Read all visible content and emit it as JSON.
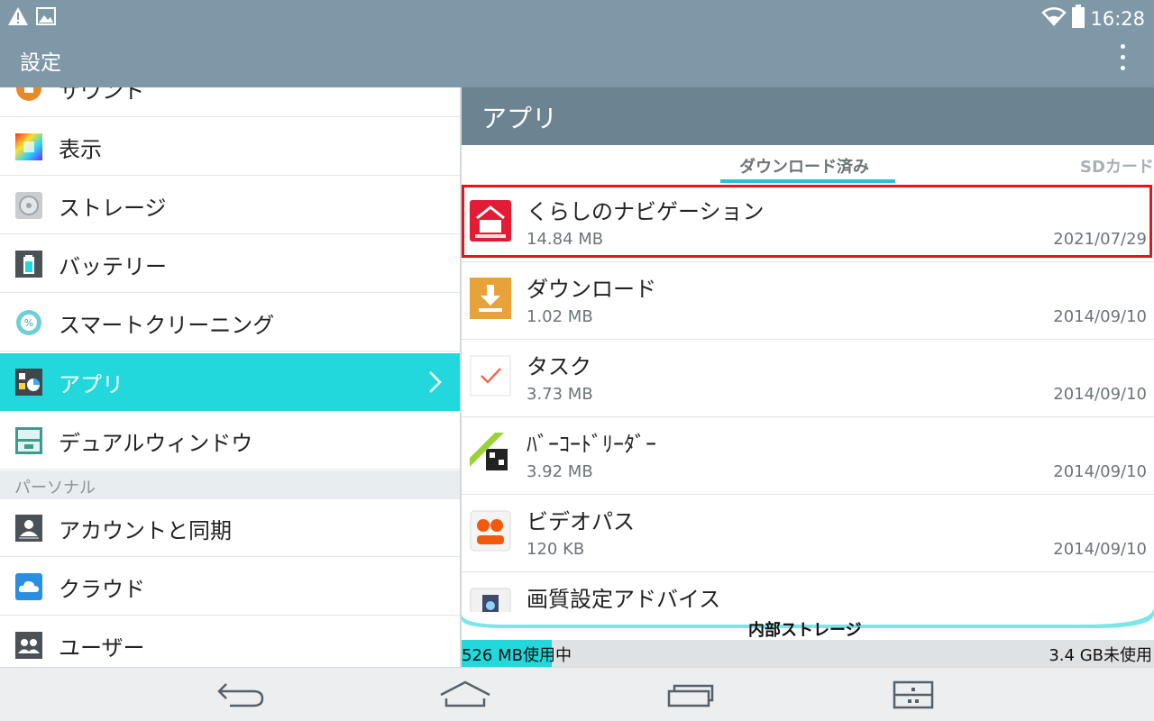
{
  "status_bar": {
    "time": "16:28",
    "icons": [
      "warning-icon",
      "image-icon",
      "wifi-icon",
      "battery-icon"
    ]
  },
  "action_bar": {
    "title": "設定",
    "overflow_icon": "more-vert-icon"
  },
  "sidebar": {
    "items": [
      {
        "label": "サウンド",
        "icon": "sound-icon"
      },
      {
        "label": "表示",
        "icon": "display-icon"
      },
      {
        "label": "ストレージ",
        "icon": "storage-icon"
      },
      {
        "label": "バッテリー",
        "icon": "battery-icon"
      },
      {
        "label": "スマートクリーニング",
        "icon": "smart-cleaning-icon"
      },
      {
        "label": "アプリ",
        "icon": "apps-icon",
        "active": true
      },
      {
        "label": "デュアルウィンドウ",
        "icon": "dual-window-icon"
      }
    ],
    "section_personal": "パーソナル",
    "personal_items": [
      {
        "label": "アカウントと同期",
        "icon": "account-sync-icon"
      },
      {
        "label": "クラウド",
        "icon": "cloud-icon"
      },
      {
        "label": "ユーザー",
        "icon": "users-icon"
      }
    ]
  },
  "apps_panel": {
    "title": "アプリ",
    "tabs": [
      {
        "label": "ダウンロード済み",
        "selected": true
      },
      {
        "label": "SDカード"
      }
    ],
    "apps": [
      {
        "name": "くらしのナビゲーション",
        "size": "14.84 MB",
        "date": "2021/07/29",
        "icon": "kurashi-navigation-icon"
      },
      {
        "name": "ダウンロード",
        "size": "1.02 MB",
        "date": "2014/09/10",
        "icon": "download-icon"
      },
      {
        "name": "タスク",
        "size": "3.73 MB",
        "date": "2014/09/10",
        "icon": "task-icon"
      },
      {
        "name": "ﾊﾞｰｺｰﾄﾞﾘｰﾀﾞｰ",
        "size": "3.92 MB",
        "date": "2014/09/10",
        "icon": "barcode-reader-icon"
      },
      {
        "name": "ビデオパス",
        "size": "120 KB",
        "date": "2014/09/10",
        "icon": "video-pass-icon"
      },
      {
        "name": "画質設定アドバイス",
        "size": "",
        "date": "",
        "icon": "image-quality-icon"
      }
    ],
    "storage": {
      "title": "内部ストレージ",
      "used": "526 MB使用中",
      "free": "3.4 GB未使用",
      "used_fraction": 0.13,
      "accent": "#22d8dc"
    }
  },
  "nav_bar": {
    "buttons": [
      "back-icon",
      "home-icon",
      "recents-icon",
      "menu-icon"
    ]
  },
  "colors": {
    "action_bar": "#7f98a8",
    "panel_header": "#6c8492",
    "accent": "#22d8dc",
    "highlight": "#e8141c"
  }
}
